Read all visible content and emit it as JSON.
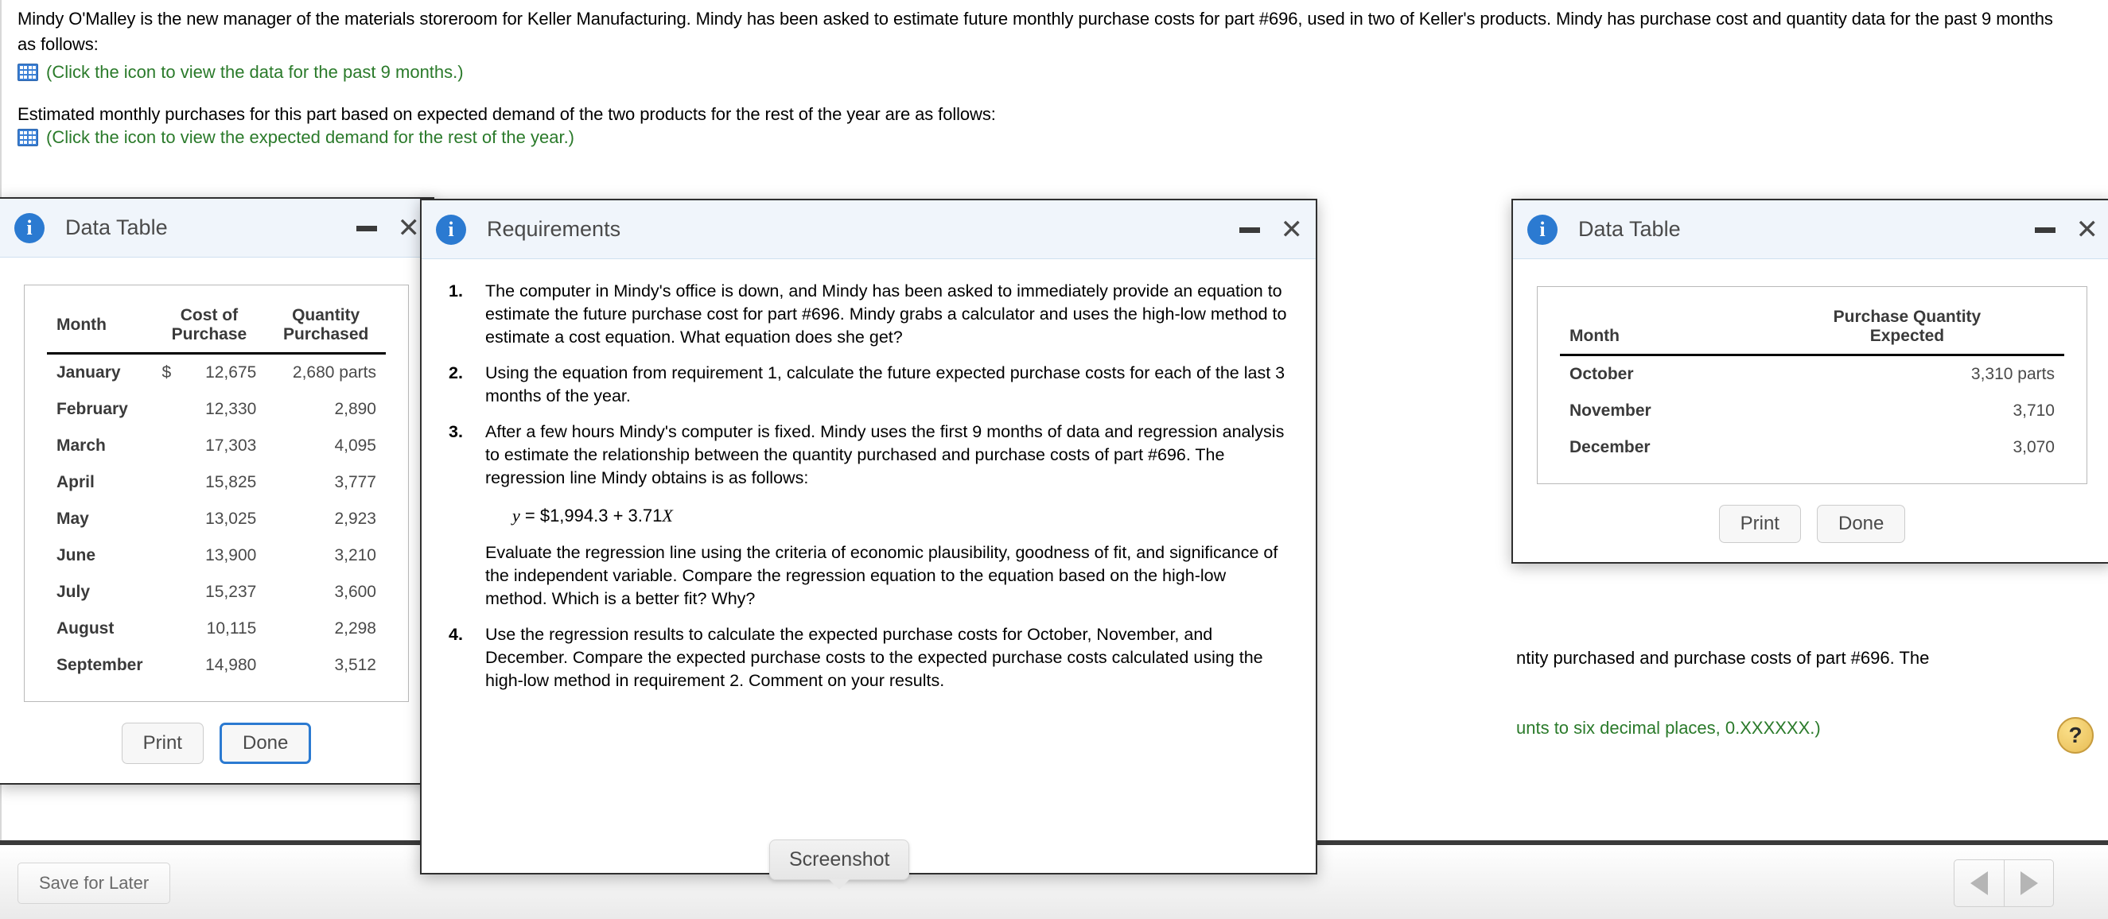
{
  "problem": {
    "paragraph1": "Mindy O'Malley is the new manager of the materials storeroom for Keller Manufacturing. Mindy has been asked to estimate future monthly purchase costs for part #696, used in two of Keller's products. Mindy has purchase cost and quantity data for the past 9 months as follows:",
    "link1": "(Click the icon to view the data for the past 9 months.)",
    "paragraph2": "Estimated monthly purchases for this part based on expected demand of the two products for the rest of the year are as follows:",
    "link2": "(Click the icon to view the expected demand for the rest of the year.)",
    "bg_fragment_text": "ntity purchased and purchase costs of part #696. The",
    "bg_fragment_green": "unts to six decimal places, 0.XXXXXX.)"
  },
  "dialog1": {
    "title": "Data Table",
    "columns": [
      "Month",
      "Cost of Purchase",
      "Quantity Purchased"
    ],
    "rows": [
      {
        "month": "January",
        "currency": "$",
        "cost": "12,675",
        "qty": "2,680 parts"
      },
      {
        "month": "February",
        "currency": "",
        "cost": "12,330",
        "qty": "2,890"
      },
      {
        "month": "March",
        "currency": "",
        "cost": "17,303",
        "qty": "4,095"
      },
      {
        "month": "April",
        "currency": "",
        "cost": "15,825",
        "qty": "3,777"
      },
      {
        "month": "May",
        "currency": "",
        "cost": "13,025",
        "qty": "2,923"
      },
      {
        "month": "June",
        "currency": "",
        "cost": "13,900",
        "qty": "3,210"
      },
      {
        "month": "July",
        "currency": "",
        "cost": "15,237",
        "qty": "3,600"
      },
      {
        "month": "August",
        "currency": "",
        "cost": "10,115",
        "qty": "2,298"
      },
      {
        "month": "September",
        "currency": "",
        "cost": "14,980",
        "qty": "3,512"
      }
    ],
    "print_label": "Print",
    "done_label": "Done"
  },
  "dialog2": {
    "title": "Requirements",
    "items": [
      "The computer in Mindy's office is down, and Mindy has been asked to immediately provide an equation to estimate the future purchase cost for part #696. Mindy grabs a calculator and uses the high-low method to estimate a cost equation. What equation does she get?",
      "Using the equation from requirement 1, calculate the future expected purchase costs for each of the last 3 months of the year.",
      "After a few hours Mindy's computer is fixed. Mindy uses the first 9 months of data and regression analysis to estimate the relationship between the quantity purchased and purchase costs of part #696. The regression line Mindy obtains is as follows:",
      "Use the regression results to calculate the expected purchase costs for October, November, and December. Compare the expected purchase costs to the expected purchase costs calculated using the high-low method in requirement 2. Comment on your results."
    ],
    "equation": "y = $1,994.3 + 3.71X",
    "item3_continued": "Evaluate the regression line using the criteria of economic plausibility, goodness of fit, and significance of the independent variable. Compare the regression equation to the equation based on the high-low method. Which is a better fit? Why?"
  },
  "dialog3": {
    "title": "Data Table",
    "columns": [
      "Month",
      "Purchase Quantity Expected"
    ],
    "column2_line1": "Purchase Quantity",
    "column2_line2": "Expected",
    "rows": [
      {
        "month": "October",
        "qty": "3,310 parts"
      },
      {
        "month": "November",
        "qty": "3,710"
      },
      {
        "month": "December",
        "qty": "3,070"
      }
    ],
    "print_label": "Print",
    "done_label": "Done"
  },
  "toolbar": {
    "save_for_later": "Save for Later",
    "screenshot_tooltip": "Screenshot",
    "help_label": "?"
  },
  "colors": {
    "accent_blue": "#2b7ad1",
    "link_green": "#2a7a2a",
    "dialog_header_bg": "#f0f5fb"
  }
}
